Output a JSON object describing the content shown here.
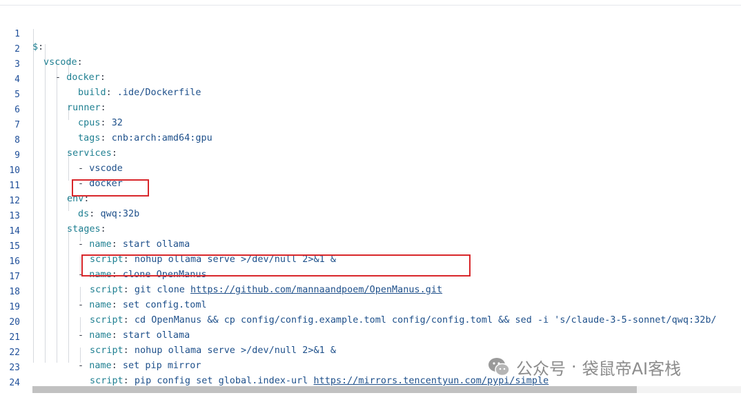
{
  "editor": {
    "lines": [
      {
        "n": "1",
        "key": "$",
        "value": ""
      },
      {
        "n": "2",
        "key": "vscode",
        "value": ""
      },
      {
        "n": "3",
        "key": "docker",
        "value": ""
      },
      {
        "n": "4",
        "key": "build",
        "value": ".ide/Dockerfile"
      },
      {
        "n": "5",
        "key": "runner",
        "value": ""
      },
      {
        "n": "6",
        "key": "cpus",
        "value": "32"
      },
      {
        "n": "7",
        "key": "tags",
        "value": "cnb:arch:amd64:gpu"
      },
      {
        "n": "8",
        "key": "services",
        "value": ""
      },
      {
        "n": "9",
        "key": "",
        "value": "vscode"
      },
      {
        "n": "10",
        "key": "",
        "value": "docker"
      },
      {
        "n": "11",
        "key": "env",
        "value": ""
      },
      {
        "n": "12",
        "key": "ds",
        "value": "qwq:32b"
      },
      {
        "n": "13",
        "key": "stages",
        "value": ""
      },
      {
        "n": "14",
        "key": "name",
        "value": "start ollama"
      },
      {
        "n": "15",
        "key": "script",
        "value": "nohup ollama serve >/dev/null 2>&1 &"
      },
      {
        "n": "16",
        "key": "name",
        "value": "clone OpenManus"
      },
      {
        "n": "17",
        "key": "script",
        "value_prefix": "git clone ",
        "link": "https://github.com/mannaandpoem/OpenManus.git"
      },
      {
        "n": "18",
        "key": "name",
        "value": "set config.toml"
      },
      {
        "n": "19",
        "key": "script",
        "value": "cd OpenManus && cp config/config.example.toml config/config.toml && sed -i 's/claude-3-5-sonnet/qwq:32b/"
      },
      {
        "n": "20",
        "key": "name",
        "value": "start ollama"
      },
      {
        "n": "21",
        "key": "script",
        "value": "nohup ollama serve >/dev/null 2>&1 &"
      },
      {
        "n": "22",
        "key": "name",
        "value": "set pip mirror"
      },
      {
        "n": "23",
        "key": "script",
        "value_prefix": "pip config set global.index-url ",
        "link": "https://mirrors.tencentyun.com/pypi/simple"
      },
      {
        "n": "24",
        "key": "",
        "value": ""
      }
    ]
  },
  "watermark": {
    "brand": "公众号",
    "separator": "·",
    "author": "袋鼠帝AI客栈"
  },
  "colors": {
    "highlight_border": "#d8262a",
    "key": "#1e7f91",
    "value": "#1d4f8a",
    "line_number": "#1f4f99"
  }
}
